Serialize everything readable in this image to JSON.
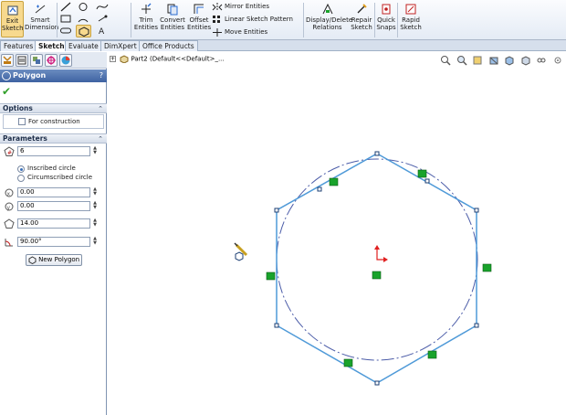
{
  "ribbon": {
    "exit_sketch": "Exit Sketch",
    "smart_dimension": "Smart Dimension",
    "trim_entities": "Trim Entities",
    "convert_entities": "Convert Entities",
    "offset_entities": "Offset Entities",
    "mirror_entities": "Mirror Entities",
    "linear_sketch_pattern": "Linear Sketch Pattern",
    "move_entities": "Move Entities",
    "display_delete_relations": "Display/Delete Relations",
    "repair_sketch": "Repair Sketch",
    "quick_snaps": "Quick Snaps",
    "rapid_sketch": "Rapid Sketch"
  },
  "tabs": [
    "Features",
    "Sketch",
    "Evaluate",
    "DimXpert",
    "Office Products"
  ],
  "active_tab": "Sketch",
  "property_manager": {
    "title": "Polygon",
    "help": "?",
    "options_header": "Options",
    "for_construction_label": "For construction",
    "parameters_header": "Parameters",
    "sides": "6",
    "inscribed_label": "Inscribed circle",
    "circumscribed_label": "Circumscribed circle",
    "center_x": "0.00",
    "center_y": "0.00",
    "diameter": "14.00",
    "angle": "90.00°",
    "new_polygon_label": "New Polygon"
  },
  "tree": {
    "part_label": "Part2  (Default<<Default>_..."
  },
  "colors": {
    "sketch_blue": "#4f9ad8",
    "construction_blue": "#4b5ca8",
    "relation_green": "#19a32b",
    "origin_red": "#e02020"
  }
}
